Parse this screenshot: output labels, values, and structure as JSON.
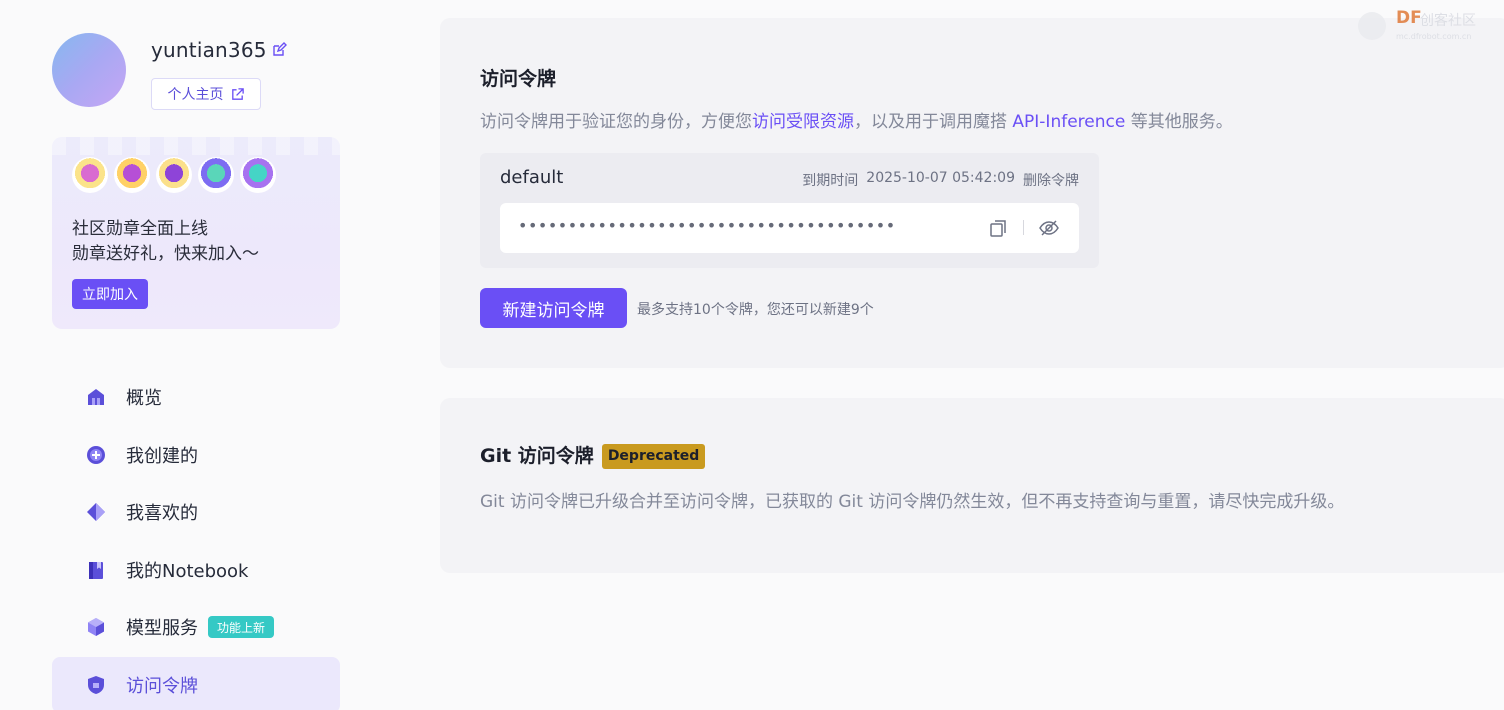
{
  "profile": {
    "username": "yuntian365",
    "home_label": "个人主页"
  },
  "badge_card": {
    "line1": "社区勋章全面上线",
    "line2": "勋章送好礼，快来加入～",
    "join_label": "立即加入"
  },
  "nav": {
    "items": [
      {
        "label": "概览"
      },
      {
        "label": "我创建的"
      },
      {
        "label": "我喜欢的"
      },
      {
        "label": "我的Notebook"
      },
      {
        "label": "模型服务",
        "tag": "功能上新"
      },
      {
        "label": "访问令牌",
        "active": true
      }
    ]
  },
  "access_token": {
    "title": "访问令牌",
    "desc_prefix": "访问令牌用于验证您的身份，方便您",
    "desc_link1": "访问受限资源",
    "desc_middle": "，以及用于调用魔搭 ",
    "desc_link2": "API-Inference",
    "desc_suffix": " 等其他服务。",
    "token": {
      "name": "default",
      "expire_label": "到期时间",
      "expire_time": "2025-10-07 05:42:09",
      "delete_label": "删除令牌",
      "masked_value": "••••••••••••••••••••••••••••••••••••••"
    },
    "create_label": "新建访问令牌",
    "create_hint": "最多支持10个令牌，您还可以新建9个"
  },
  "git_token": {
    "title": "Git 访问令牌",
    "badge": "Deprecated",
    "desc": "Git 访问令牌已升级合并至访问令牌，已获取的 Git 访问令牌仍然生效，但不再支持查询与重置，请尽快完成升级。"
  },
  "watermark": {
    "brand": "DF",
    "name": "创客社区",
    "url": "mc.dfrobot.com.cn"
  },
  "colors": {
    "accent": "#6a4ff5",
    "badge_deprecated": "#c99a1f",
    "tag_new": "#35c9c5",
    "active_bg": "#ebe8fc"
  }
}
